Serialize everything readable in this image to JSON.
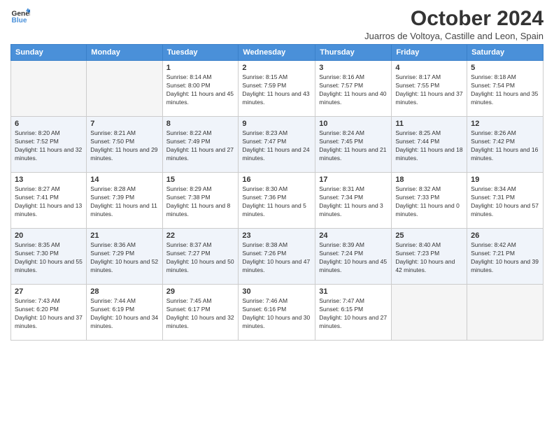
{
  "logo": {
    "line1": "General",
    "line2": "Blue"
  },
  "title": "October 2024",
  "subtitle": "Juarros de Voltoya, Castille and Leon, Spain",
  "days_of_week": [
    "Sunday",
    "Monday",
    "Tuesday",
    "Wednesday",
    "Thursday",
    "Friday",
    "Saturday"
  ],
  "weeks": [
    [
      {
        "day": "",
        "info": ""
      },
      {
        "day": "",
        "info": ""
      },
      {
        "day": "1",
        "info": "Sunrise: 8:14 AM\nSunset: 8:00 PM\nDaylight: 11 hours and 45 minutes."
      },
      {
        "day": "2",
        "info": "Sunrise: 8:15 AM\nSunset: 7:59 PM\nDaylight: 11 hours and 43 minutes."
      },
      {
        "day": "3",
        "info": "Sunrise: 8:16 AM\nSunset: 7:57 PM\nDaylight: 11 hours and 40 minutes."
      },
      {
        "day": "4",
        "info": "Sunrise: 8:17 AM\nSunset: 7:55 PM\nDaylight: 11 hours and 37 minutes."
      },
      {
        "day": "5",
        "info": "Sunrise: 8:18 AM\nSunset: 7:54 PM\nDaylight: 11 hours and 35 minutes."
      }
    ],
    [
      {
        "day": "6",
        "info": "Sunrise: 8:20 AM\nSunset: 7:52 PM\nDaylight: 11 hours and 32 minutes."
      },
      {
        "day": "7",
        "info": "Sunrise: 8:21 AM\nSunset: 7:50 PM\nDaylight: 11 hours and 29 minutes."
      },
      {
        "day": "8",
        "info": "Sunrise: 8:22 AM\nSunset: 7:49 PM\nDaylight: 11 hours and 27 minutes."
      },
      {
        "day": "9",
        "info": "Sunrise: 8:23 AM\nSunset: 7:47 PM\nDaylight: 11 hours and 24 minutes."
      },
      {
        "day": "10",
        "info": "Sunrise: 8:24 AM\nSunset: 7:45 PM\nDaylight: 11 hours and 21 minutes."
      },
      {
        "day": "11",
        "info": "Sunrise: 8:25 AM\nSunset: 7:44 PM\nDaylight: 11 hours and 18 minutes."
      },
      {
        "day": "12",
        "info": "Sunrise: 8:26 AM\nSunset: 7:42 PM\nDaylight: 11 hours and 16 minutes."
      }
    ],
    [
      {
        "day": "13",
        "info": "Sunrise: 8:27 AM\nSunset: 7:41 PM\nDaylight: 11 hours and 13 minutes."
      },
      {
        "day": "14",
        "info": "Sunrise: 8:28 AM\nSunset: 7:39 PM\nDaylight: 11 hours and 11 minutes."
      },
      {
        "day": "15",
        "info": "Sunrise: 8:29 AM\nSunset: 7:38 PM\nDaylight: 11 hours and 8 minutes."
      },
      {
        "day": "16",
        "info": "Sunrise: 8:30 AM\nSunset: 7:36 PM\nDaylight: 11 hours and 5 minutes."
      },
      {
        "day": "17",
        "info": "Sunrise: 8:31 AM\nSunset: 7:34 PM\nDaylight: 11 hours and 3 minutes."
      },
      {
        "day": "18",
        "info": "Sunrise: 8:32 AM\nSunset: 7:33 PM\nDaylight: 11 hours and 0 minutes."
      },
      {
        "day": "19",
        "info": "Sunrise: 8:34 AM\nSunset: 7:31 PM\nDaylight: 10 hours and 57 minutes."
      }
    ],
    [
      {
        "day": "20",
        "info": "Sunrise: 8:35 AM\nSunset: 7:30 PM\nDaylight: 10 hours and 55 minutes."
      },
      {
        "day": "21",
        "info": "Sunrise: 8:36 AM\nSunset: 7:29 PM\nDaylight: 10 hours and 52 minutes."
      },
      {
        "day": "22",
        "info": "Sunrise: 8:37 AM\nSunset: 7:27 PM\nDaylight: 10 hours and 50 minutes."
      },
      {
        "day": "23",
        "info": "Sunrise: 8:38 AM\nSunset: 7:26 PM\nDaylight: 10 hours and 47 minutes."
      },
      {
        "day": "24",
        "info": "Sunrise: 8:39 AM\nSunset: 7:24 PM\nDaylight: 10 hours and 45 minutes."
      },
      {
        "day": "25",
        "info": "Sunrise: 8:40 AM\nSunset: 7:23 PM\nDaylight: 10 hours and 42 minutes."
      },
      {
        "day": "26",
        "info": "Sunrise: 8:42 AM\nSunset: 7:21 PM\nDaylight: 10 hours and 39 minutes."
      }
    ],
    [
      {
        "day": "27",
        "info": "Sunrise: 7:43 AM\nSunset: 6:20 PM\nDaylight: 10 hours and 37 minutes."
      },
      {
        "day": "28",
        "info": "Sunrise: 7:44 AM\nSunset: 6:19 PM\nDaylight: 10 hours and 34 minutes."
      },
      {
        "day": "29",
        "info": "Sunrise: 7:45 AM\nSunset: 6:17 PM\nDaylight: 10 hours and 32 minutes."
      },
      {
        "day": "30",
        "info": "Sunrise: 7:46 AM\nSunset: 6:16 PM\nDaylight: 10 hours and 30 minutes."
      },
      {
        "day": "31",
        "info": "Sunrise: 7:47 AM\nSunset: 6:15 PM\nDaylight: 10 hours and 27 minutes."
      },
      {
        "day": "",
        "info": ""
      },
      {
        "day": "",
        "info": ""
      }
    ]
  ]
}
